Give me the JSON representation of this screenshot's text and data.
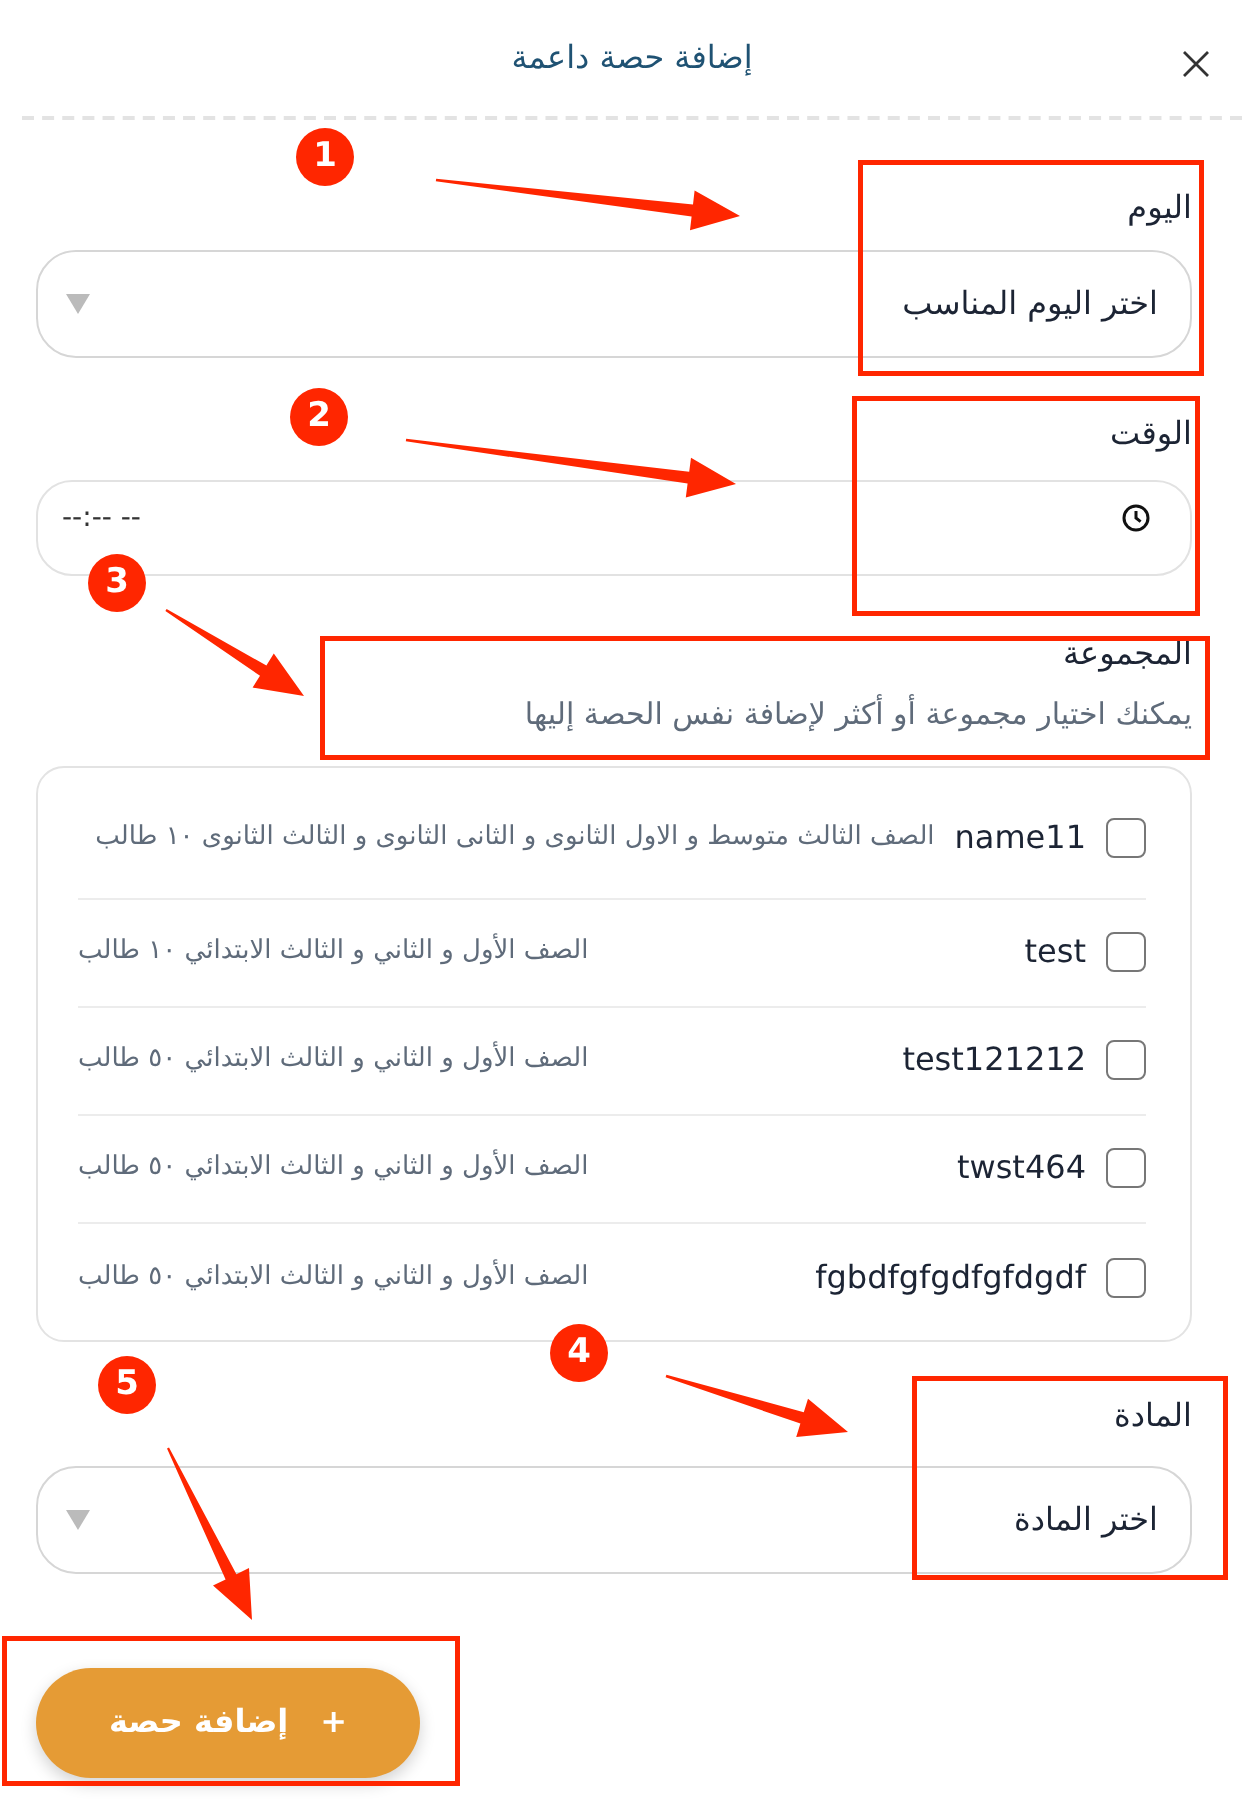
{
  "dialog": {
    "title": "إضافة حصة داعمة"
  },
  "day": {
    "label": "اليوم",
    "placeholder": "اختر اليوم المناسب"
  },
  "time": {
    "label": "الوقت",
    "value": "--:-- --"
  },
  "group": {
    "label": "المجموعة",
    "hint": "يمكنك اختيار مجموعة أو أكثر لإضافة نفس الحصة إليها"
  },
  "groups": [
    {
      "name": "name11",
      "description": "الصف الثالث متوسط و الاول الثانوى و الثانى الثانوى و الثالث الثانوى ١٠ طالب",
      "checked": false
    },
    {
      "name": "test",
      "description": "الصف الأول و الثاني و الثالث الابتدائي ١٠ طالب",
      "checked": false
    },
    {
      "name": "test121212",
      "description": "الصف الأول و الثاني و الثالث الابتدائي ٥٠ طالب",
      "checked": false
    },
    {
      "name": "twst464",
      "description": "الصف الأول و الثاني و الثالث الابتدائي ٥٠ طالب",
      "checked": false
    },
    {
      "name": "fgbdfgfgdfgfdgdf",
      "description": "الصف الأول و الثاني و الثالث الابتدائي ٥٠ طالب",
      "checked": false
    }
  ],
  "subject": {
    "label": "المادة",
    "placeholder": "اختر المادة"
  },
  "submit": {
    "icon": "+",
    "label": "إضافة حصة"
  },
  "annotations": [
    {
      "number": "1"
    },
    {
      "number": "2"
    },
    {
      "number": "3"
    },
    {
      "number": "4"
    },
    {
      "number": "5"
    }
  ]
}
